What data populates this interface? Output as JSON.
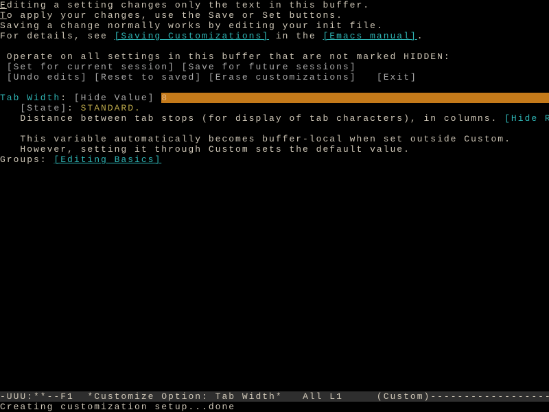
{
  "help": {
    "line1a": "E",
    "line1b": "diting a setting changes only the text in this buffer.",
    "line2a": "T",
    "line2b": "o apply your changes, use the Save or Set buttons.",
    "line3": "Saving a change normally works by editing your init file.",
    "line4a": "For details, see ",
    "link1": "[Saving Customizations]",
    "line4b": " in the ",
    "link2": "[Emacs manual]",
    "line4c": "."
  },
  "operate": {
    "heading": " Operate on all settings in this buffer that are not marked HIDDEN:",
    "btn_set": "[Set for current session]",
    "btn_save": "[Save for future sessions]",
    "btn_undo": "[Undo edits]",
    "btn_reset": "[Reset to saved]",
    "btn_erase": "[Erase customizations]",
    "btn_exit": "[Exit]"
  },
  "option": {
    "label": "Tab Width",
    "colon": ": ",
    "hide_value": "[Hide Value]",
    "value_gap": " ",
    "value": "8",
    "state_label": "   [State]",
    "state_colon": ": ",
    "state_value": "STANDARD.",
    "desc1": "   Distance between tab stops (for display of tab characters), in columns. ",
    "hide_rest": "[Hide Rest]",
    "desc2": "   This variable automatically becomes buffer-local when set outside Custom.",
    "desc3": "   However, setting it through Custom sets the default value.",
    "groups_label": "Groups: ",
    "group_link": "[Editing Basics]"
  },
  "modeline": {
    "left": "-UUU:**--F1  ",
    "buffer": "*Customize Option: Tab Width*",
    "pos": "   All L1    ",
    "mode": " (Custom)",
    "dashes": "------------------------------"
  },
  "echo": "Creating customization setup...done"
}
